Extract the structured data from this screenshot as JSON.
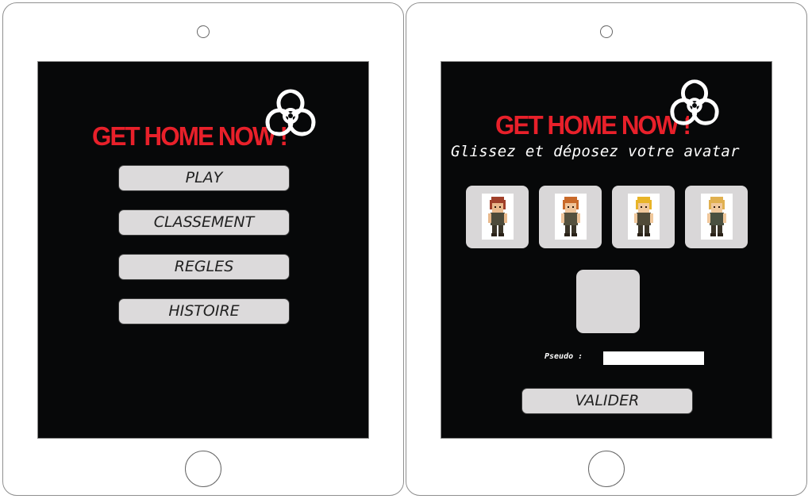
{
  "menu_screen": {
    "logo_text": "GET HOME NOW !",
    "buttons": [
      "PLAY",
      "CLASSEMENT",
      "REGLES",
      "HISTOIRE"
    ]
  },
  "avatar_screen": {
    "logo_text": "GET HOME NOW !",
    "subtitle": "Glissez et déposez votre avatar",
    "avatars": [
      {
        "hair": "#a0402a",
        "skin": "#e9b98c",
        "cloth": "#4d4a3a"
      },
      {
        "hair": "#c96a2a",
        "skin": "#efc49a",
        "cloth": "#55513e"
      },
      {
        "hair": "#e8b428",
        "skin": "#f0c89c",
        "cloth": "#504a38"
      },
      {
        "hair": "#e0b050",
        "skin": "#f0c89c",
        "cloth": "#4a5040"
      }
    ],
    "pseudo_label": "Pseudo :",
    "pseudo_value": "",
    "submit_label": "VALIDER"
  },
  "colors": {
    "screen_bg": "#070809",
    "logo_red": "#e8202a",
    "button_bg": "#dcdadb",
    "card_bg": "#d9d7d8"
  }
}
